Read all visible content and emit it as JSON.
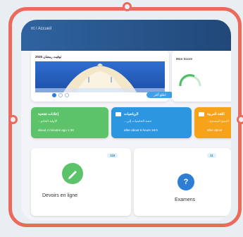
{
  "breadcrumb": "nt / Accueil",
  "announcement": {
    "title": "توقيت رمضان 2025",
    "button": "اطلع أكثر"
  },
  "score": {
    "title": "Mon Score"
  },
  "notices": [
    {
      "title": "إعلانات تفتحية",
      "desc": "...الأولية الخاتم",
      "meta": "about 4 minutes ago 1:38",
      "color": "#5cc36a",
      "icon": "flag-icon"
    },
    {
      "title": "الرياضيات",
      "desc": "...حصة الحاسبات إلى",
      "meta": "after about 6 hours 16:0",
      "color": "#2d96e0",
      "icon": "video-icon"
    },
    {
      "title": "اللغة العربية",
      "desc": "...النسخ المصحح",
      "meta": "after about",
      "color": "#f6a21b",
      "icon": "video-icon"
    }
  ],
  "modules": [
    {
      "label": "Devoirs en ligne",
      "count": "118",
      "icon_color": "#5cc36a",
      "icon": "pencil-icon"
    },
    {
      "label": "Examens",
      "count": "11",
      "icon_color": "#2d7fd6",
      "icon": "question-icon"
    }
  ]
}
